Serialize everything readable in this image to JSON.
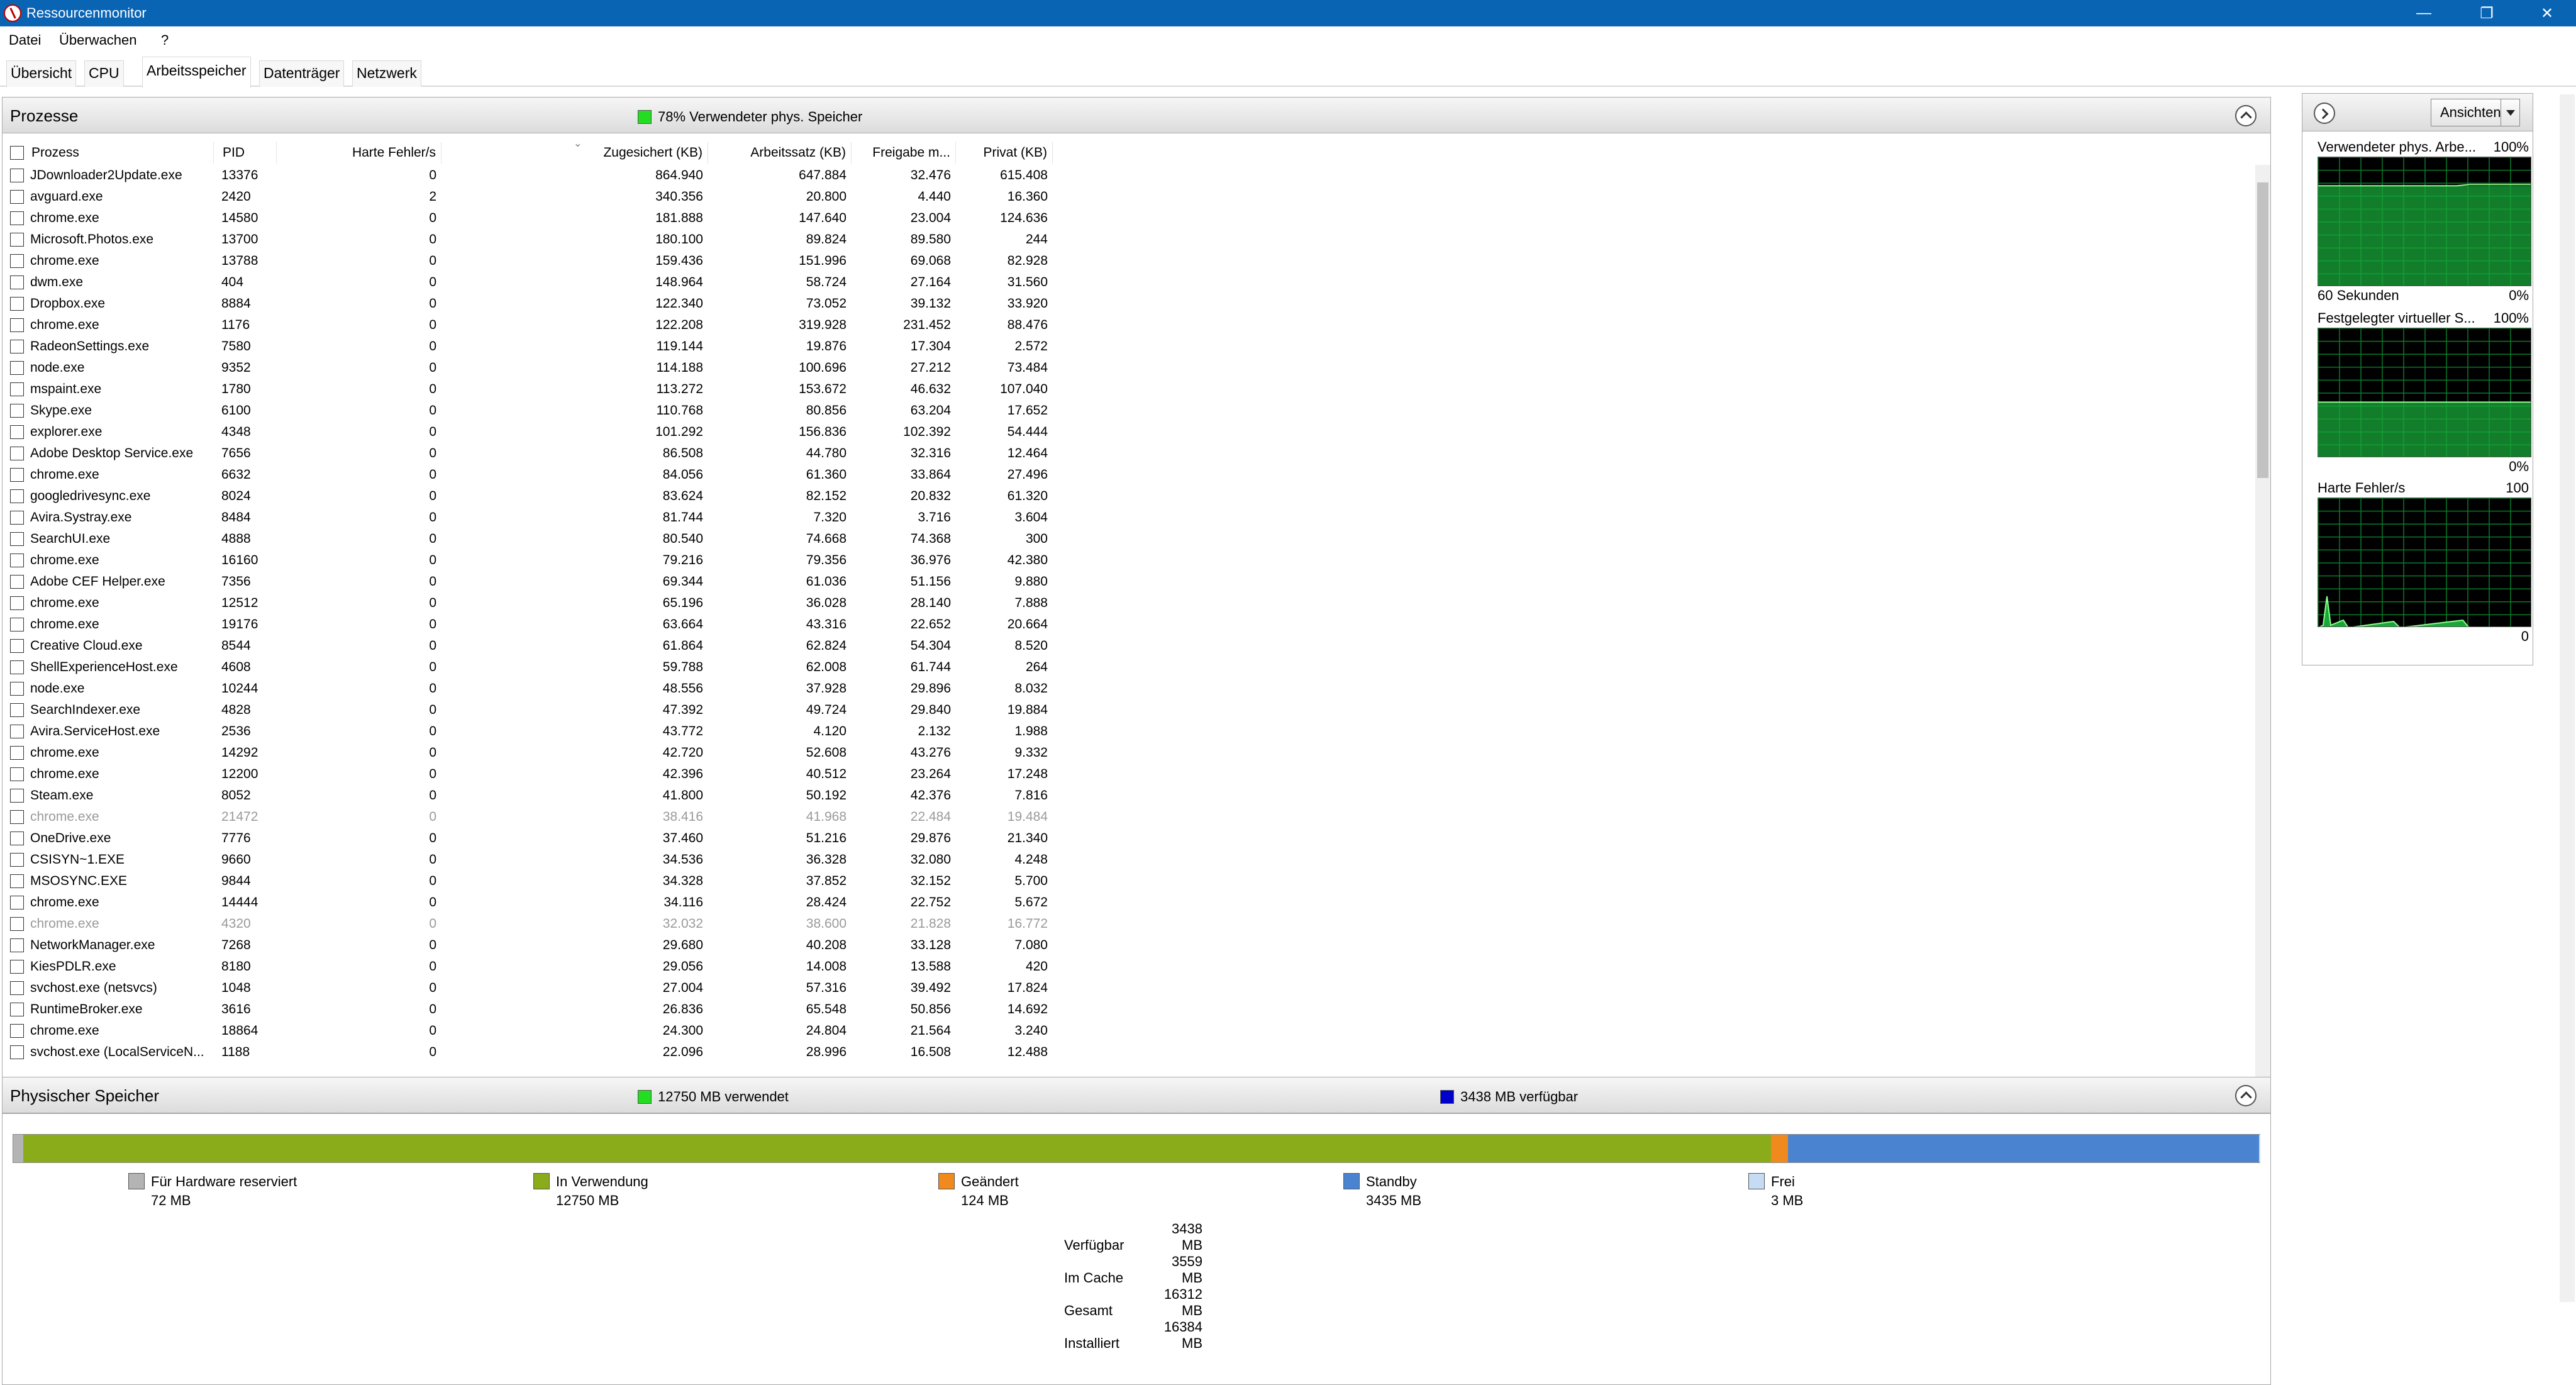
{
  "window": {
    "title": "Ressourcenmonitor",
    "minimize": "—",
    "maximize": "❐",
    "close": "✕"
  },
  "menu": [
    "Datei",
    "Überwachen",
    "?"
  ],
  "tabs": [
    "Übersicht",
    "CPU",
    "Arbeitsspeicher",
    "Datenträger",
    "Netzwerk"
  ],
  "active_tab": "Arbeitsspeicher",
  "processes": {
    "title": "Prozesse",
    "legend": "78% Verwendeter phys. Speicher",
    "legend_color": "#22dd22",
    "columns": [
      "Prozess",
      "PID",
      "Harte Fehler/s",
      "Zugesichert (KB)",
      "Arbeitssatz (KB)",
      "Freigabe m...",
      "Privat (KB)"
    ],
    "rows": [
      {
        "name": "JDownloader2Update.exe",
        "pid": "13376",
        "hf": "0",
        "zu": "864.940",
        "ar": "647.884",
        "fr": "32.476",
        "pr": "615.408",
        "dim": false
      },
      {
        "name": "avguard.exe",
        "pid": "2420",
        "hf": "2",
        "zu": "340.356",
        "ar": "20.800",
        "fr": "4.440",
        "pr": "16.360",
        "dim": false
      },
      {
        "name": "chrome.exe",
        "pid": "14580",
        "hf": "0",
        "zu": "181.888",
        "ar": "147.640",
        "fr": "23.004",
        "pr": "124.636",
        "dim": false
      },
      {
        "name": "Microsoft.Photos.exe",
        "pid": "13700",
        "hf": "0",
        "zu": "180.100",
        "ar": "89.824",
        "fr": "89.580",
        "pr": "244",
        "dim": false
      },
      {
        "name": "chrome.exe",
        "pid": "13788",
        "hf": "0",
        "zu": "159.436",
        "ar": "151.996",
        "fr": "69.068",
        "pr": "82.928",
        "dim": false
      },
      {
        "name": "dwm.exe",
        "pid": "404",
        "hf": "0",
        "zu": "148.964",
        "ar": "58.724",
        "fr": "27.164",
        "pr": "31.560",
        "dim": false
      },
      {
        "name": "Dropbox.exe",
        "pid": "8884",
        "hf": "0",
        "zu": "122.340",
        "ar": "73.052",
        "fr": "39.132",
        "pr": "33.920",
        "dim": false
      },
      {
        "name": "chrome.exe",
        "pid": "1176",
        "hf": "0",
        "zu": "122.208",
        "ar": "319.928",
        "fr": "231.452",
        "pr": "88.476",
        "dim": false
      },
      {
        "name": "RadeonSettings.exe",
        "pid": "7580",
        "hf": "0",
        "zu": "119.144",
        "ar": "19.876",
        "fr": "17.304",
        "pr": "2.572",
        "dim": false
      },
      {
        "name": "node.exe",
        "pid": "9352",
        "hf": "0",
        "zu": "114.188",
        "ar": "100.696",
        "fr": "27.212",
        "pr": "73.484",
        "dim": false
      },
      {
        "name": "mspaint.exe",
        "pid": "1780",
        "hf": "0",
        "zu": "113.272",
        "ar": "153.672",
        "fr": "46.632",
        "pr": "107.040",
        "dim": false
      },
      {
        "name": "Skype.exe",
        "pid": "6100",
        "hf": "0",
        "zu": "110.768",
        "ar": "80.856",
        "fr": "63.204",
        "pr": "17.652",
        "dim": false
      },
      {
        "name": "explorer.exe",
        "pid": "4348",
        "hf": "0",
        "zu": "101.292",
        "ar": "156.836",
        "fr": "102.392",
        "pr": "54.444",
        "dim": false
      },
      {
        "name": "Adobe Desktop Service.exe",
        "pid": "7656",
        "hf": "0",
        "zu": "86.508",
        "ar": "44.780",
        "fr": "32.316",
        "pr": "12.464",
        "dim": false
      },
      {
        "name": "chrome.exe",
        "pid": "6632",
        "hf": "0",
        "zu": "84.056",
        "ar": "61.360",
        "fr": "33.864",
        "pr": "27.496",
        "dim": false
      },
      {
        "name": "googledrivesync.exe",
        "pid": "8024",
        "hf": "0",
        "zu": "83.624",
        "ar": "82.152",
        "fr": "20.832",
        "pr": "61.320",
        "dim": false
      },
      {
        "name": "Avira.Systray.exe",
        "pid": "8484",
        "hf": "0",
        "zu": "81.744",
        "ar": "7.320",
        "fr": "3.716",
        "pr": "3.604",
        "dim": false
      },
      {
        "name": "SearchUI.exe",
        "pid": "4888",
        "hf": "0",
        "zu": "80.540",
        "ar": "74.668",
        "fr": "74.368",
        "pr": "300",
        "dim": false
      },
      {
        "name": "chrome.exe",
        "pid": "16160",
        "hf": "0",
        "zu": "79.216",
        "ar": "79.356",
        "fr": "36.976",
        "pr": "42.380",
        "dim": false
      },
      {
        "name": "Adobe CEF Helper.exe",
        "pid": "7356",
        "hf": "0",
        "zu": "69.344",
        "ar": "61.036",
        "fr": "51.156",
        "pr": "9.880",
        "dim": false
      },
      {
        "name": "chrome.exe",
        "pid": "12512",
        "hf": "0",
        "zu": "65.196",
        "ar": "36.028",
        "fr": "28.140",
        "pr": "7.888",
        "dim": false
      },
      {
        "name": "chrome.exe",
        "pid": "19176",
        "hf": "0",
        "zu": "63.664",
        "ar": "43.316",
        "fr": "22.652",
        "pr": "20.664",
        "dim": false
      },
      {
        "name": "Creative Cloud.exe",
        "pid": "8544",
        "hf": "0",
        "zu": "61.864",
        "ar": "62.824",
        "fr": "54.304",
        "pr": "8.520",
        "dim": false
      },
      {
        "name": "ShellExperienceHost.exe",
        "pid": "4608",
        "hf": "0",
        "zu": "59.788",
        "ar": "62.008",
        "fr": "61.744",
        "pr": "264",
        "dim": false
      },
      {
        "name": "node.exe",
        "pid": "10244",
        "hf": "0",
        "zu": "48.556",
        "ar": "37.928",
        "fr": "29.896",
        "pr": "8.032",
        "dim": false
      },
      {
        "name": "SearchIndexer.exe",
        "pid": "4828",
        "hf": "0",
        "zu": "47.392",
        "ar": "49.724",
        "fr": "29.840",
        "pr": "19.884",
        "dim": false
      },
      {
        "name": "Avira.ServiceHost.exe",
        "pid": "2536",
        "hf": "0",
        "zu": "43.772",
        "ar": "4.120",
        "fr": "2.132",
        "pr": "1.988",
        "dim": false
      },
      {
        "name": "chrome.exe",
        "pid": "14292",
        "hf": "0",
        "zu": "42.720",
        "ar": "52.608",
        "fr": "43.276",
        "pr": "9.332",
        "dim": false
      },
      {
        "name": "chrome.exe",
        "pid": "12200",
        "hf": "0",
        "zu": "42.396",
        "ar": "40.512",
        "fr": "23.264",
        "pr": "17.248",
        "dim": false
      },
      {
        "name": "Steam.exe",
        "pid": "8052",
        "hf": "0",
        "zu": "41.800",
        "ar": "50.192",
        "fr": "42.376",
        "pr": "7.816",
        "dim": false
      },
      {
        "name": "chrome.exe",
        "pid": "21472",
        "hf": "0",
        "zu": "38.416",
        "ar": "41.968",
        "fr": "22.484",
        "pr": "19.484",
        "dim": true
      },
      {
        "name": "OneDrive.exe",
        "pid": "7776",
        "hf": "0",
        "zu": "37.460",
        "ar": "51.216",
        "fr": "29.876",
        "pr": "21.340",
        "dim": false
      },
      {
        "name": "CSISYN~1.EXE",
        "pid": "9660",
        "hf": "0",
        "zu": "34.536",
        "ar": "36.328",
        "fr": "32.080",
        "pr": "4.248",
        "dim": false
      },
      {
        "name": "MSOSYNC.EXE",
        "pid": "9844",
        "hf": "0",
        "zu": "34.328",
        "ar": "37.852",
        "fr": "32.152",
        "pr": "5.700",
        "dim": false
      },
      {
        "name": "chrome.exe",
        "pid": "14444",
        "hf": "0",
        "zu": "34.116",
        "ar": "28.424",
        "fr": "22.752",
        "pr": "5.672",
        "dim": false
      },
      {
        "name": "chrome.exe",
        "pid": "4320",
        "hf": "0",
        "zu": "32.032",
        "ar": "38.600",
        "fr": "21.828",
        "pr": "16.772",
        "dim": true
      },
      {
        "name": "NetworkManager.exe",
        "pid": "7268",
        "hf": "0",
        "zu": "29.680",
        "ar": "40.208",
        "fr": "33.128",
        "pr": "7.080",
        "dim": false
      },
      {
        "name": "KiesPDLR.exe",
        "pid": "8180",
        "hf": "0",
        "zu": "29.056",
        "ar": "14.008",
        "fr": "13.588",
        "pr": "420",
        "dim": false
      },
      {
        "name": "svchost.exe (netsvcs)",
        "pid": "1048",
        "hf": "0",
        "zu": "27.004",
        "ar": "57.316",
        "fr": "39.492",
        "pr": "17.824",
        "dim": false
      },
      {
        "name": "RuntimeBroker.exe",
        "pid": "3616",
        "hf": "0",
        "zu": "26.836",
        "ar": "65.548",
        "fr": "50.856",
        "pr": "14.692",
        "dim": false
      },
      {
        "name": "chrome.exe",
        "pid": "18864",
        "hf": "0",
        "zu": "24.300",
        "ar": "24.804",
        "fr": "21.564",
        "pr": "3.240",
        "dim": false
      },
      {
        "name": "svchost.exe (LocalServiceN...",
        "pid": "1188",
        "hf": "0",
        "zu": "22.096",
        "ar": "28.996",
        "fr": "16.508",
        "pr": "12.488",
        "dim": false
      }
    ]
  },
  "physical": {
    "title": "Physischer Speicher",
    "used_legend": "12750 MB verwendet",
    "used_color": "#22dd22",
    "avail_legend": "3438 MB verfügbar",
    "avail_color": "#0000cc",
    "segments": [
      {
        "label": "Für Hardware reserviert",
        "value": "72 MB",
        "mb": 72,
        "color": "#b4b4b4"
      },
      {
        "label": "In Verwendung",
        "value": "12750 MB",
        "mb": 12750,
        "color": "#8bac1a"
      },
      {
        "label": "Geändert",
        "value": "124 MB",
        "mb": 124,
        "color": "#f0891e"
      },
      {
        "label": "Standby",
        "value": "3435 MB",
        "mb": 3435,
        "color": "#4a84d0"
      },
      {
        "label": "Frei",
        "value": "3 MB",
        "mb": 3,
        "color": "#c6dcf5"
      }
    ],
    "stats": [
      {
        "label": "Verfügbar",
        "value": "3438 MB"
      },
      {
        "label": "Im Cache",
        "value": "3559 MB"
      },
      {
        "label": "Gesamt",
        "value": "16312 MB"
      },
      {
        "label": "Installiert",
        "value": "16384 MB"
      }
    ]
  },
  "side": {
    "view_button": "Ansichten",
    "graphs": [
      {
        "title": "Verwendeter phys. Arbe...",
        "max": "100%",
        "min_left": "60 Sekunden",
        "min": "0%",
        "level": 0.78
      },
      {
        "title": "Festgelegter virtueller S...",
        "max": "100%",
        "min_left": "",
        "min": "0%",
        "level": 0.43
      },
      {
        "title": "Harte Fehler/s",
        "max": "100",
        "min_left": "",
        "min": "0",
        "level": 0.0
      }
    ]
  }
}
